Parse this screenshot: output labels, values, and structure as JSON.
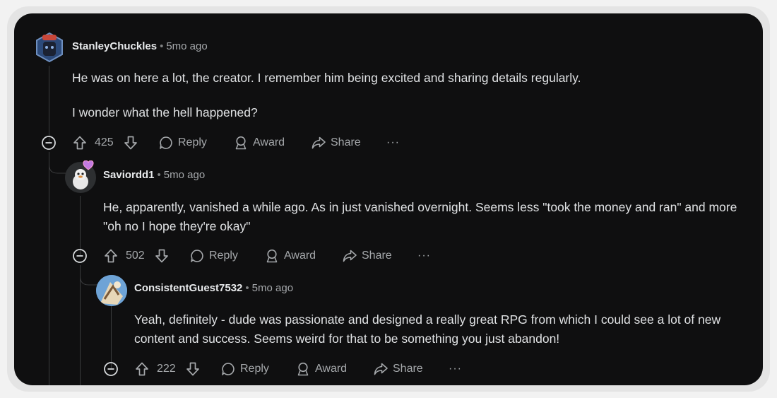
{
  "comments": [
    {
      "username": "StanleyChuckles",
      "separator": "•",
      "time": "5mo ago",
      "paragraphs": [
        "He was on here a lot, the creator. I remember him being excited and sharing details regularly.",
        "I wonder what the hell happened?"
      ],
      "votes": "425",
      "reply_label": "Reply",
      "award_label": "Award",
      "share_label": "Share",
      "more_label": "···"
    },
    {
      "username": "Saviordd1",
      "separator": "•",
      "time": "5mo ago",
      "paragraphs": [
        "He, apparently, vanished a while ago. As in just vanished overnight. Seems less \"took the money and ran\" and more \"oh no I hope they're okay\""
      ],
      "votes": "502",
      "reply_label": "Reply",
      "award_label": "Award",
      "share_label": "Share",
      "more_label": "···"
    },
    {
      "username": "ConsistentGuest7532",
      "separator": "•",
      "time": "5mo ago",
      "paragraphs": [
        "Yeah, definitely - dude was passionate and designed a really great RPG from which I could see a lot of new content and success. Seems weird for that to be something you just abandon!"
      ],
      "votes": "222",
      "reply_label": "Reply",
      "award_label": "Award",
      "share_label": "Share",
      "more_label": "···"
    }
  ]
}
